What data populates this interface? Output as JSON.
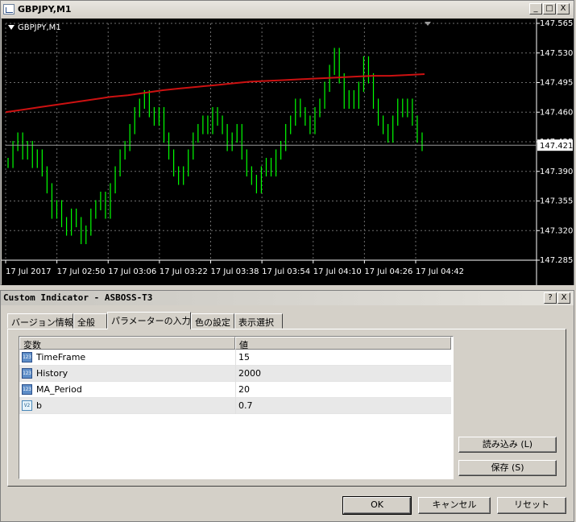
{
  "chart_window": {
    "title": "GBPJPY,M1",
    "symbol_label": "GBPJPY,M1",
    "buttons": {
      "minimize": "_",
      "maximize": "□",
      "close": "X"
    }
  },
  "chart_data": {
    "type": "line",
    "symbol": "GBPJPY",
    "timeframe": "M1",
    "y_ticks": [
      "147.565",
      "147.530",
      "147.495",
      "147.460",
      "147.425",
      "147.390",
      "147.355",
      "147.320",
      "147.285"
    ],
    "x_ticks": [
      "17 Jul 2017",
      "17 Jul 02:50",
      "17 Jul 03:06",
      "17 Jul 03:22",
      "17 Jul 03:38",
      "17 Jul 03:54",
      "17 Jul 04:10",
      "17 Jul 04:26",
      "17 Jul 04:42"
    ],
    "ylim": [
      147.285,
      147.565
    ],
    "current_price": "147.421",
    "grid": true,
    "price_color": "#00ff00",
    "ma_color": "#cc1111",
    "price_series": [
      147.4,
      147.42,
      147.43,
      147.41,
      147.42,
      147.4,
      147.41,
      147.39,
      147.37,
      147.34,
      147.35,
      147.33,
      147.32,
      147.34,
      147.33,
      147.31,
      147.32,
      147.34,
      147.35,
      147.36,
      147.34,
      147.37,
      147.39,
      147.41,
      147.42,
      147.44,
      147.46,
      147.47,
      147.48,
      147.46,
      147.45,
      147.46,
      147.43,
      147.41,
      147.39,
      147.38,
      147.39,
      147.41,
      147.43,
      147.44,
      147.45,
      147.44,
      147.46,
      147.45,
      147.44,
      147.42,
      147.43,
      147.44,
      147.41,
      147.39,
      147.38,
      147.37,
      147.39,
      147.4,
      147.39,
      147.41,
      147.42,
      147.44,
      147.45,
      147.47,
      147.46,
      147.45,
      147.44,
      147.46,
      147.47,
      147.49,
      147.51,
      147.53,
      147.5,
      147.47,
      147.48,
      147.47,
      147.49,
      147.52,
      147.5,
      147.47,
      147.45,
      147.44,
      147.43,
      147.45,
      147.47,
      147.46,
      147.47,
      147.45,
      147.43,
      147.42
    ],
    "ma_series": [
      147.46,
      147.463,
      147.466,
      147.469,
      147.472,
      147.475,
      147.478,
      147.48,
      147.483,
      147.486,
      147.488,
      147.49,
      147.492,
      147.494,
      147.496,
      147.497,
      147.498,
      147.499,
      147.5,
      147.501,
      147.502,
      147.503,
      147.503,
      147.504,
      147.505
    ]
  },
  "dialog": {
    "title": "Custom Indicator - ASBOSS-T3",
    "help_button": "?",
    "close_button": "X",
    "tabs": [
      "バージョン情報",
      "全般",
      "パラメーターの入力",
      "色の設定",
      "表示選択"
    ],
    "active_tab": "パラメーターの入力",
    "table": {
      "headers": [
        "変数",
        "値"
      ],
      "rows": [
        {
          "type": "123",
          "name": "TimeFrame",
          "value": "15"
        },
        {
          "type": "123",
          "name": "History",
          "value": "2000"
        },
        {
          "type": "123",
          "name": "MA_Period",
          "value": "20"
        },
        {
          "type": "V2",
          "name": "b",
          "value": "0.7"
        }
      ]
    },
    "load_button": "読み込み (L)",
    "save_button": "保存 (S)",
    "ok_button": "OK",
    "cancel_button": "キャンセル",
    "reset_button": "リセット"
  }
}
